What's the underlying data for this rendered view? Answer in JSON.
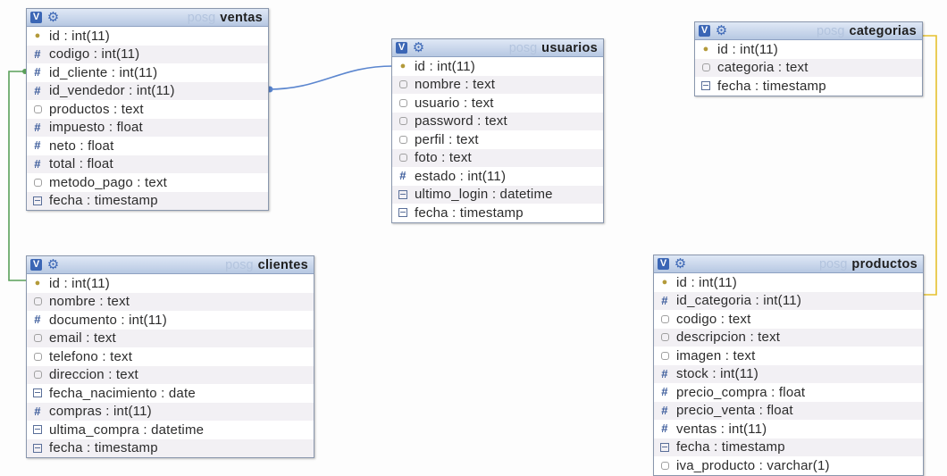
{
  "diagram": {
    "tables": [
      {
        "id": "ventas",
        "db": "posg",
        "name": "ventas",
        "columns": [
          {
            "text": "id : int(11)",
            "icon": "key"
          },
          {
            "text": "codigo : int(11)",
            "icon": "number"
          },
          {
            "text": "id_cliente : int(11)",
            "icon": "number"
          },
          {
            "text": "id_vendedor : int(11)",
            "icon": "number"
          },
          {
            "text": "productos : text",
            "icon": "text"
          },
          {
            "text": "impuesto : float",
            "icon": "number"
          },
          {
            "text": "neto : float",
            "icon": "number"
          },
          {
            "text": "total : float",
            "icon": "number"
          },
          {
            "text": "metodo_pago : text",
            "icon": "text"
          },
          {
            "text": "fecha : timestamp",
            "icon": "date"
          }
        ]
      },
      {
        "id": "usuarios",
        "db": "posg",
        "name": "usuarios",
        "columns": [
          {
            "text": "id : int(11)",
            "icon": "key"
          },
          {
            "text": "nombre : text",
            "icon": "text"
          },
          {
            "text": "usuario : text",
            "icon": "text"
          },
          {
            "text": "password : text",
            "icon": "text"
          },
          {
            "text": "perfil : text",
            "icon": "text"
          },
          {
            "text": "foto : text",
            "icon": "text"
          },
          {
            "text": "estado : int(11)",
            "icon": "number"
          },
          {
            "text": "ultimo_login : datetime",
            "icon": "date"
          },
          {
            "text": "fecha : timestamp",
            "icon": "date"
          }
        ]
      },
      {
        "id": "categorias",
        "db": "posg",
        "name": "categorias",
        "columns": [
          {
            "text": "id : int(11)",
            "icon": "key"
          },
          {
            "text": "categoria : text",
            "icon": "text"
          },
          {
            "text": "fecha : timestamp",
            "icon": "date"
          }
        ]
      },
      {
        "id": "clientes",
        "db": "posg",
        "name": "clientes",
        "columns": [
          {
            "text": "id : int(11)",
            "icon": "key"
          },
          {
            "text": "nombre : text",
            "icon": "text"
          },
          {
            "text": "documento : int(11)",
            "icon": "number"
          },
          {
            "text": "email : text",
            "icon": "text"
          },
          {
            "text": "telefono : text",
            "icon": "text"
          },
          {
            "text": "direccion : text",
            "icon": "text"
          },
          {
            "text": "fecha_nacimiento : date",
            "icon": "date"
          },
          {
            "text": "compras : int(11)",
            "icon": "number"
          },
          {
            "text": "ultima_compra : datetime",
            "icon": "date"
          },
          {
            "text": "fecha : timestamp",
            "icon": "date"
          }
        ]
      },
      {
        "id": "productos",
        "db": "posg",
        "name": "productos",
        "columns": [
          {
            "text": "id : int(11)",
            "icon": "key"
          },
          {
            "text": "id_categoria : int(11)",
            "icon": "number"
          },
          {
            "text": "codigo : text",
            "icon": "text"
          },
          {
            "text": "descripcion : text",
            "icon": "text"
          },
          {
            "text": "imagen : text",
            "icon": "text"
          },
          {
            "text": "stock : int(11)",
            "icon": "number"
          },
          {
            "text": "precio_compra : float",
            "icon": "number"
          },
          {
            "text": "precio_venta : float",
            "icon": "number"
          },
          {
            "text": "ventas : int(11)",
            "icon": "number"
          },
          {
            "text": "fecha : timestamp",
            "icon": "date"
          },
          {
            "text": "iva_producto : varchar(1)",
            "icon": "text"
          }
        ]
      }
    ],
    "relations": [
      {
        "from": "ventas.id_cliente",
        "to": "clientes.id",
        "color": "#5aa05a"
      },
      {
        "from": "ventas.id_vendedor",
        "to": "usuarios.id",
        "color": "#5b86cf"
      },
      {
        "from": "productos.id_categoria",
        "to": "categorias.id",
        "color": "#e6c12e"
      }
    ],
    "colors": {
      "header_check": "#3b66b5",
      "db_prefix": "#b3c4de",
      "key_icon": "#b39a3a",
      "number_icon": "#3a5a9a"
    },
    "check_label": "V",
    "gear_icon": "gear-icon"
  }
}
